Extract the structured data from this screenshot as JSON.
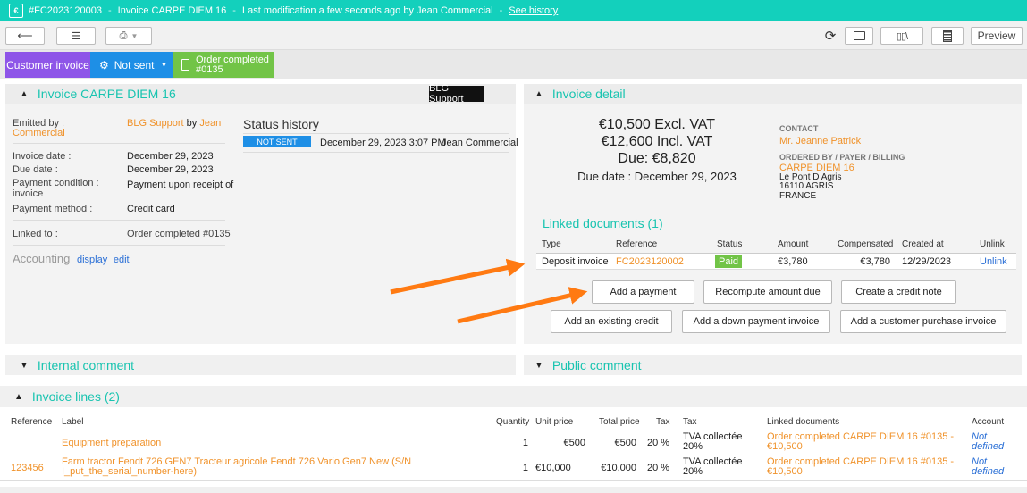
{
  "topbar": {
    "doc_number": "#FC2023120003",
    "doc_title": "Invoice CARPE DIEM 16",
    "modification": "Last modification a few seconds ago by Jean Commercial",
    "history_link": "See history"
  },
  "toolbar": {
    "preview_label": "Preview"
  },
  "status_tabs": {
    "customer_invoice": "Customer invoice",
    "not_sent": "Not sent",
    "order_completed_line1": "Order completed",
    "order_completed_line2": "#0135"
  },
  "left_panel": {
    "title": "Invoice CARPE DIEM 16",
    "badge": "BLG Support",
    "emitted_label": "Emitted by :",
    "emitted_company": "BLG Support",
    "emitted_by": "by",
    "emitted_person": "Jean Commercial",
    "invoice_date_label": "Invoice date :",
    "invoice_date_value": "December 29, 2023",
    "due_date_label": "Due date :",
    "due_date_value": "December 29, 2023",
    "payment_condition_label": "Payment condition : invoice",
    "payment_condition_value": "Payment upon receipt of",
    "payment_method_label": "Payment method :",
    "payment_method_value": "Credit card",
    "linked_to_label": "Linked to :",
    "linked_to_value": "Order completed #0135",
    "accounting_label": "Accounting",
    "accounting_display": "display",
    "accounting_edit": "edit",
    "status_history_title": "Status history",
    "history_status": "NOT SENT",
    "history_date": "December 29, 2023 3:07 PM",
    "history_user": "Jean Commercial"
  },
  "right_panel": {
    "title": "Invoice detail",
    "excl_vat": "€10,500 Excl. VAT",
    "incl_vat": "€12,600 Incl. VAT",
    "due": "Due: €8,820",
    "due_date": "Due date : December 29, 2023",
    "contact_label": "CONTACT",
    "contact_name": "Mr. Jeanne Patrick",
    "ordered_label": "ORDERED BY / PAYER / BILLING",
    "company": "CARPE DIEM 16",
    "address1": "Le Pont D Agris",
    "address2": "16110 AGRIS",
    "country": "FRANCE",
    "linked_title": "Linked documents (1)",
    "linked_headers": {
      "type": "Type",
      "reference": "Reference",
      "status": "Status",
      "amount": "Amount",
      "compensated": "Compensated",
      "created": "Created at",
      "unlink": "Unlink"
    },
    "linked_row": {
      "type": "Deposit invoice",
      "reference": "FC2023120002",
      "status": "Paid",
      "amount": "€3,780",
      "compensated": "€3,780",
      "created": "12/29/2023",
      "unlink": "Unlink"
    },
    "buttons": {
      "add_payment": "Add a payment",
      "recompute": "Recompute amount due",
      "credit_note": "Create a credit note",
      "existing_credit": "Add an existing credit",
      "down_payment": "Add a down payment invoice",
      "purchase_invoice": "Add a customer purchase invoice"
    }
  },
  "comments": {
    "internal": "Internal comment",
    "public": "Public comment"
  },
  "invoice_lines": {
    "title": "Invoice lines (2)",
    "headers": {
      "reference": "Reference",
      "label": "Label",
      "quantity": "Quantity",
      "unit_price": "Unit price",
      "total_price": "Total price",
      "tax": "Tax",
      "tax_name": "Tax",
      "linked": "Linked documents",
      "account": "Account"
    },
    "rows": [
      {
        "reference": "",
        "label": "Equipment preparation",
        "label2": "",
        "quantity": "1",
        "unit_price": "€500",
        "total_price": "€500",
        "tax": "20 %",
        "tax_name1": "TVA collectée",
        "tax_name2": "20%",
        "linked1": "Order completed CARPE DIEM 16 #0135 -",
        "linked2": "€10,500",
        "account1": "Not",
        "account2": "defined"
      },
      {
        "reference": "123456",
        "label": "Farm tractor Fendt 726 GEN7 Tracteur agricole Fendt 726 Vario Gen7 New (S/N",
        "label2": "I_put_the_serial_number-here)",
        "quantity": "1",
        "unit_price": "€10,000",
        "total_price": "€10,000",
        "tax": "20 %",
        "tax_name1": "TVA collectée",
        "tax_name2": "20%",
        "linked1": "Order completed CARPE DIEM 16 #0135 -",
        "linked2": "€10,500",
        "account1": "Not",
        "account2": "defined"
      }
    ]
  },
  "colors": {
    "topbar": "#13d0bc",
    "accent_teal": "#19c4b0",
    "link_orange": "#f0922a",
    "tab_purple": "#8e55e8",
    "tab_blue": "#1e8fe6",
    "tab_green": "#72c447",
    "arrow_orange": "#ff7a12"
  }
}
